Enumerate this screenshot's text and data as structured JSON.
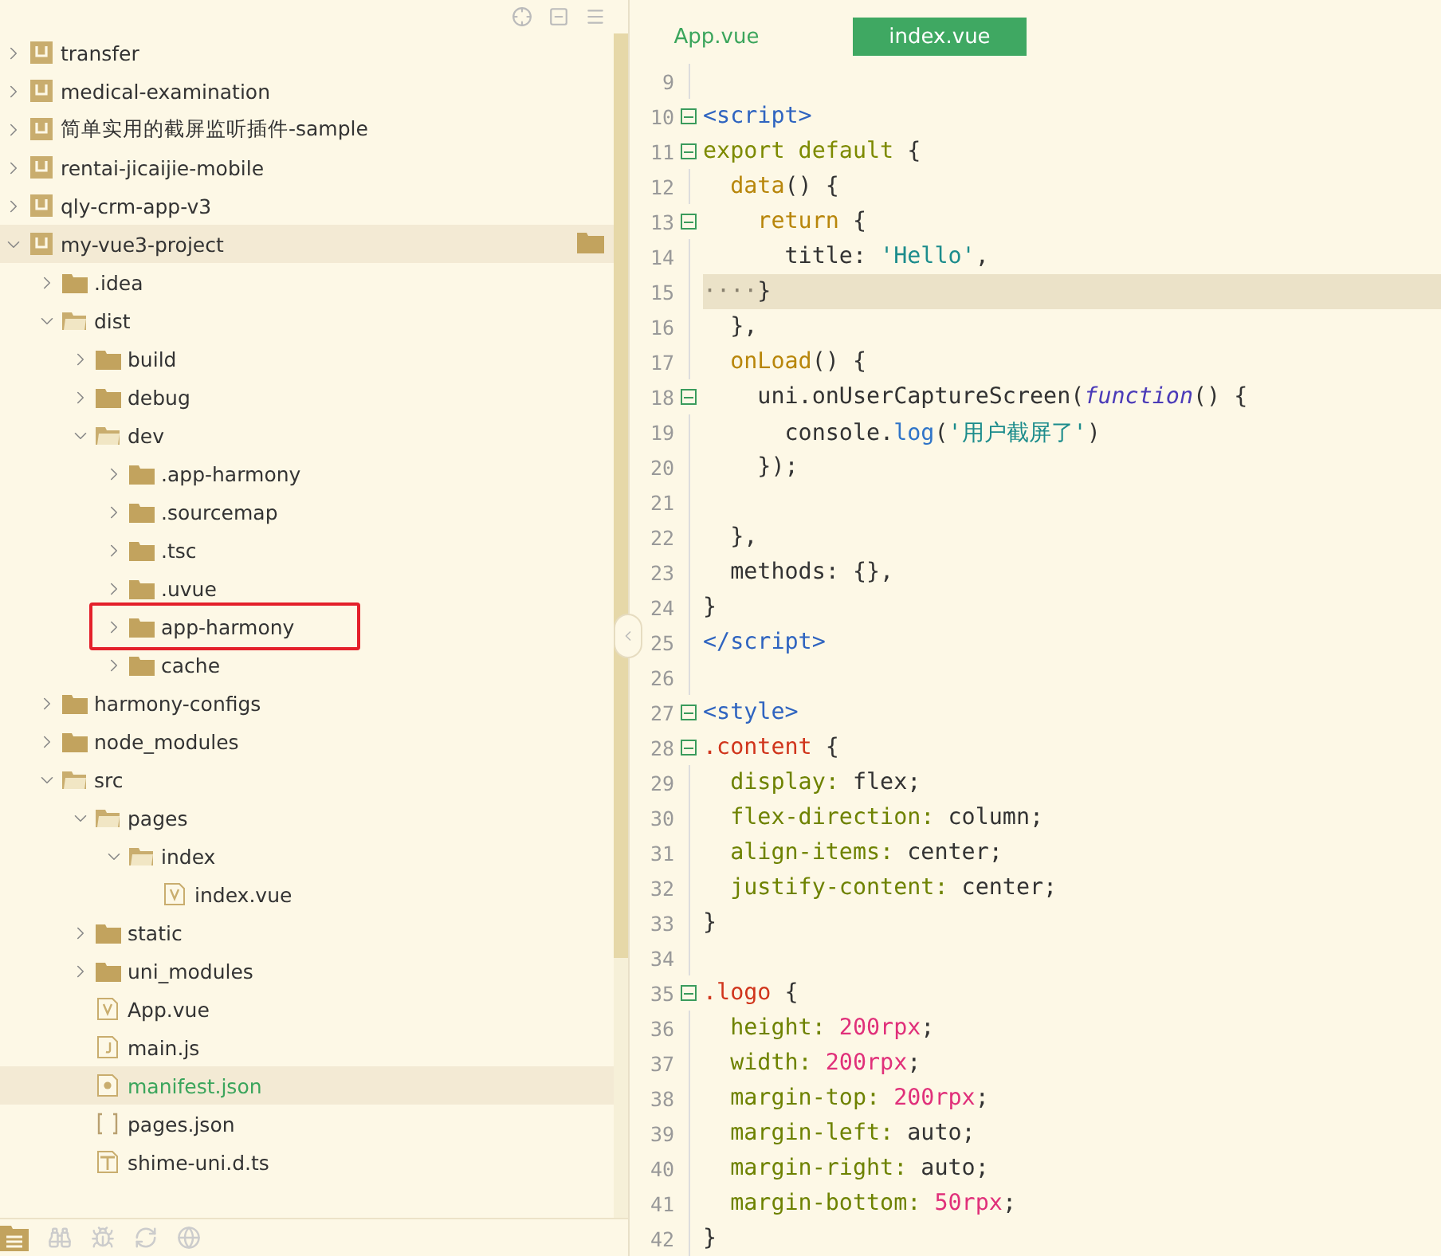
{
  "sidebar": {
    "tree": [
      {
        "name": "transfer",
        "kind": "project",
        "expanded": false,
        "active": false
      },
      {
        "name": "medical-examination",
        "kind": "project",
        "expanded": false,
        "active": false
      },
      {
        "name": "简单实用的截屏监听插件-sample",
        "kind": "project",
        "expanded": false,
        "active": false
      },
      {
        "name": "rentai-jicaijie-mobile",
        "kind": "project",
        "expanded": false,
        "active": false
      },
      {
        "name": "qly-crm-app-v3",
        "kind": "project",
        "expanded": false,
        "active": false
      },
      {
        "name": "my-vue3-project",
        "kind": "project",
        "expanded": true,
        "active": true,
        "children": [
          {
            "name": ".idea",
            "kind": "folder",
            "expanded": false
          },
          {
            "name": "dist",
            "kind": "folder",
            "expanded": true,
            "children": [
              {
                "name": "build",
                "kind": "folder",
                "expanded": false
              },
              {
                "name": "debug",
                "kind": "folder",
                "expanded": false
              },
              {
                "name": "dev",
                "kind": "folder",
                "expanded": true,
                "children": [
                  {
                    "name": ".app-harmony",
                    "kind": "folder",
                    "expanded": false
                  },
                  {
                    "name": ".sourcemap",
                    "kind": "folder",
                    "expanded": false
                  },
                  {
                    "name": ".tsc",
                    "kind": "folder",
                    "expanded": false
                  },
                  {
                    "name": ".uvue",
                    "kind": "folder",
                    "expanded": false
                  },
                  {
                    "name": "app-harmony",
                    "kind": "folder",
                    "expanded": false,
                    "highlighted": true
                  },
                  {
                    "name": "cache",
                    "kind": "folder",
                    "expanded": false
                  }
                ]
              }
            ]
          },
          {
            "name": "harmony-configs",
            "kind": "folder",
            "expanded": false
          },
          {
            "name": "node_modules",
            "kind": "folder",
            "expanded": false
          },
          {
            "name": "src",
            "kind": "folder",
            "expanded": true,
            "children": [
              {
                "name": "pages",
                "kind": "folder",
                "expanded": true,
                "children": [
                  {
                    "name": "index",
                    "kind": "folder",
                    "expanded": true,
                    "children": [
                      {
                        "name": "index.vue",
                        "kind": "vue",
                        "selected": false
                      }
                    ]
                  }
                ]
              },
              {
                "name": "static",
                "kind": "folder",
                "expanded": false
              },
              {
                "name": "uni_modules",
                "kind": "folder",
                "expanded": false
              },
              {
                "name": "App.vue",
                "kind": "vue",
                "selected": false
              },
              {
                "name": "main.js",
                "kind": "js",
                "selected": false
              },
              {
                "name": "manifest.json",
                "kind": "config",
                "selected": true
              },
              {
                "name": "pages.json",
                "kind": "json",
                "selected": false
              },
              {
                "name": "shime-uni.d.ts",
                "kind": "ts",
                "selected": false
              }
            ]
          }
        ]
      }
    ]
  },
  "editor": {
    "tabs": [
      {
        "label": "App.vue",
        "selected": false
      },
      {
        "label": "index.vue",
        "selected": true
      }
    ],
    "lines": [
      {
        "number": "9"
      },
      {
        "number": "10",
        "fold": true,
        "tokens": [
          {
            "text": "<script>",
            "kind": "tag"
          }
        ]
      },
      {
        "number": "11",
        "fold": true,
        "tokens": [
          {
            "text": "export default ",
            "kind": "keyword"
          },
          {
            "text": "{",
            "kind": "plain"
          }
        ]
      },
      {
        "number": "12",
        "tokens": [
          {
            "text": "  data",
            "kind": "method"
          },
          {
            "text": "() {",
            "kind": "plain"
          }
        ]
      },
      {
        "number": "13",
        "fold": true,
        "tokens": [
          {
            "text": "    return ",
            "kind": "method"
          },
          {
            "text": "{",
            "kind": "plain"
          }
        ]
      },
      {
        "number": "14",
        "tokens": [
          {
            "text": "      title: ",
            "kind": "plain"
          },
          {
            "text": "'Hello'",
            "kind": "string"
          },
          {
            "text": ",",
            "kind": "plain"
          }
        ]
      },
      {
        "number": "15",
        "current": true,
        "tokens": [
          {
            "text": "····",
            "kind": "whitespace"
          },
          {
            "text": "}",
            "kind": "plain"
          }
        ]
      },
      {
        "number": "16",
        "tokens": [
          {
            "text": "  },",
            "kind": "plain"
          }
        ]
      },
      {
        "number": "17",
        "tokens": [
          {
            "text": "  onLoad",
            "kind": "method"
          },
          {
            "text": "() {",
            "kind": "plain"
          }
        ]
      },
      {
        "number": "18",
        "fold": true,
        "tokens": [
          {
            "text": "    uni.onUserCaptureScreen(",
            "kind": "plain"
          },
          {
            "text": "function",
            "kind": "italic"
          },
          {
            "text": "() {",
            "kind": "plain"
          }
        ]
      },
      {
        "number": "19",
        "tokens": [
          {
            "text": "      console.",
            "kind": "plain"
          },
          {
            "text": "log",
            "kind": "call"
          },
          {
            "text": "(",
            "kind": "plain"
          },
          {
            "text": "'用户截屏了'",
            "kind": "string"
          },
          {
            "text": ")",
            "kind": "plain"
          }
        ]
      },
      {
        "number": "20",
        "tokens": [
          {
            "text": "    });",
            "kind": "plain"
          }
        ]
      },
      {
        "number": "21"
      },
      {
        "number": "22",
        "tokens": [
          {
            "text": "  },",
            "kind": "plain"
          }
        ]
      },
      {
        "number": "23",
        "tokens": [
          {
            "text": "  methods: {},",
            "kind": "plain"
          }
        ]
      },
      {
        "number": "24",
        "tokens": [
          {
            "text": "}",
            "kind": "plain"
          }
        ]
      },
      {
        "number": "25",
        "tokens": [
          {
            "text": "</script>",
            "kind": "tag"
          }
        ]
      },
      {
        "number": "26"
      },
      {
        "number": "27",
        "fold": true,
        "tokens": [
          {
            "text": "<style>",
            "kind": "tag"
          }
        ]
      },
      {
        "number": "28",
        "fold": true,
        "tokens": [
          {
            "text": ".content",
            "kind": "selector"
          },
          {
            "text": " {",
            "kind": "plain"
          }
        ]
      },
      {
        "number": "29",
        "tokens": [
          {
            "text": "  display:",
            "kind": "property"
          },
          {
            "text": " flex;",
            "kind": "plain"
          }
        ]
      },
      {
        "number": "30",
        "tokens": [
          {
            "text": "  flex-direction:",
            "kind": "property"
          },
          {
            "text": " column;",
            "kind": "plain"
          }
        ]
      },
      {
        "number": "31",
        "tokens": [
          {
            "text": "  align-items:",
            "kind": "property"
          },
          {
            "text": " center;",
            "kind": "plain"
          }
        ]
      },
      {
        "number": "32",
        "tokens": [
          {
            "text": "  justify-content:",
            "kind": "property"
          },
          {
            "text": " center;",
            "kind": "plain"
          }
        ]
      },
      {
        "number": "33",
        "tokens": [
          {
            "text": "}",
            "kind": "plain"
          }
        ]
      },
      {
        "number": "34"
      },
      {
        "number": "35",
        "fold": true,
        "tokens": [
          {
            "text": ".logo",
            "kind": "selector"
          },
          {
            "text": " {",
            "kind": "plain"
          }
        ]
      },
      {
        "number": "36",
        "tokens": [
          {
            "text": "  height: ",
            "kind": "property"
          },
          {
            "text": "200rpx",
            "kind": "number"
          },
          {
            "text": ";",
            "kind": "plain"
          }
        ]
      },
      {
        "number": "37",
        "tokens": [
          {
            "text": "  width: ",
            "kind": "property"
          },
          {
            "text": "200rpx",
            "kind": "number"
          },
          {
            "text": ";",
            "kind": "plain"
          }
        ]
      },
      {
        "number": "38",
        "tokens": [
          {
            "text": "  margin-top: ",
            "kind": "property"
          },
          {
            "text": "200rpx",
            "kind": "number"
          },
          {
            "text": ";",
            "kind": "plain"
          }
        ]
      },
      {
        "number": "39",
        "tokens": [
          {
            "text": "  margin-left:",
            "kind": "property"
          },
          {
            "text": " auto;",
            "kind": "plain"
          }
        ]
      },
      {
        "number": "40",
        "tokens": [
          {
            "text": "  margin-right:",
            "kind": "property"
          },
          {
            "text": " auto;",
            "kind": "plain"
          }
        ]
      },
      {
        "number": "41",
        "tokens": [
          {
            "text": "  margin-bottom: ",
            "kind": "property"
          },
          {
            "text": "50rpx",
            "kind": "number"
          },
          {
            "text": ";",
            "kind": "plain"
          }
        ]
      },
      {
        "number": "42",
        "tokens": [
          {
            "text": "}",
            "kind": "plain"
          }
        ]
      }
    ]
  }
}
